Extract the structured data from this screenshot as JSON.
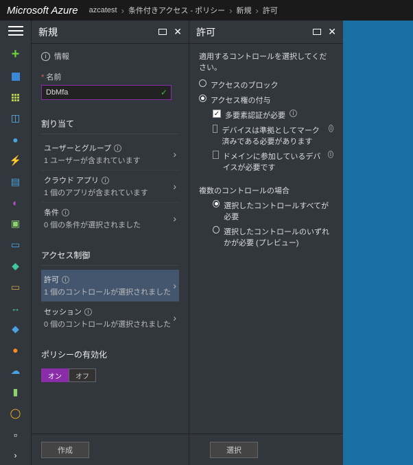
{
  "header": {
    "brand": "Microsoft Azure",
    "crumbs": [
      "azcatest",
      "条件付きアクセス - ポリシー",
      "新規",
      "許可"
    ]
  },
  "blade_new": {
    "title": "新規",
    "info_label": "情報",
    "name_label": "名前",
    "name_value": "DbMfa",
    "sect_assign": "割り当て",
    "rows_assign": [
      {
        "t1": "ユーザーとグループ",
        "t2": "1 ユーザーが含まれています",
        "info": true
      },
      {
        "t1": "クラウド アプリ",
        "t2": "1 個のアプリが含まれています",
        "info": true
      },
      {
        "t1": "条件",
        "t2": "0 個の条件が選択されました",
        "info": true
      }
    ],
    "sect_access": "アクセス制御",
    "rows_access": [
      {
        "t1": "許可",
        "t2": "1 個のコントロールが選択されました",
        "info": true,
        "sel": true
      },
      {
        "t1": "セッション",
        "t2": "0 個のコントロールが選択されました",
        "info": true
      }
    ],
    "sect_policy": "ポリシーの有効化",
    "toggle_on": "オン",
    "toggle_off": "オフ",
    "create_btn": "作成"
  },
  "blade_grant": {
    "title": "許可",
    "prompt": "適用するコントロールを選択してください。",
    "r_block": "アクセスのブロック",
    "r_grant": "アクセス権の付与",
    "chk_mfa": "多要素認証が必要",
    "chk_compliant": "デバイスは準拠としてマーク済みである必要があります",
    "chk_domain": "ドメインに参加しているデバイスが必要です",
    "sect_multi": "複数のコントロールの場合",
    "r_all": "選択したコントロールすべてが必要",
    "r_any": "選択したコントロールのいずれかが必要 (プレビュー)",
    "select_btn": "選択"
  }
}
